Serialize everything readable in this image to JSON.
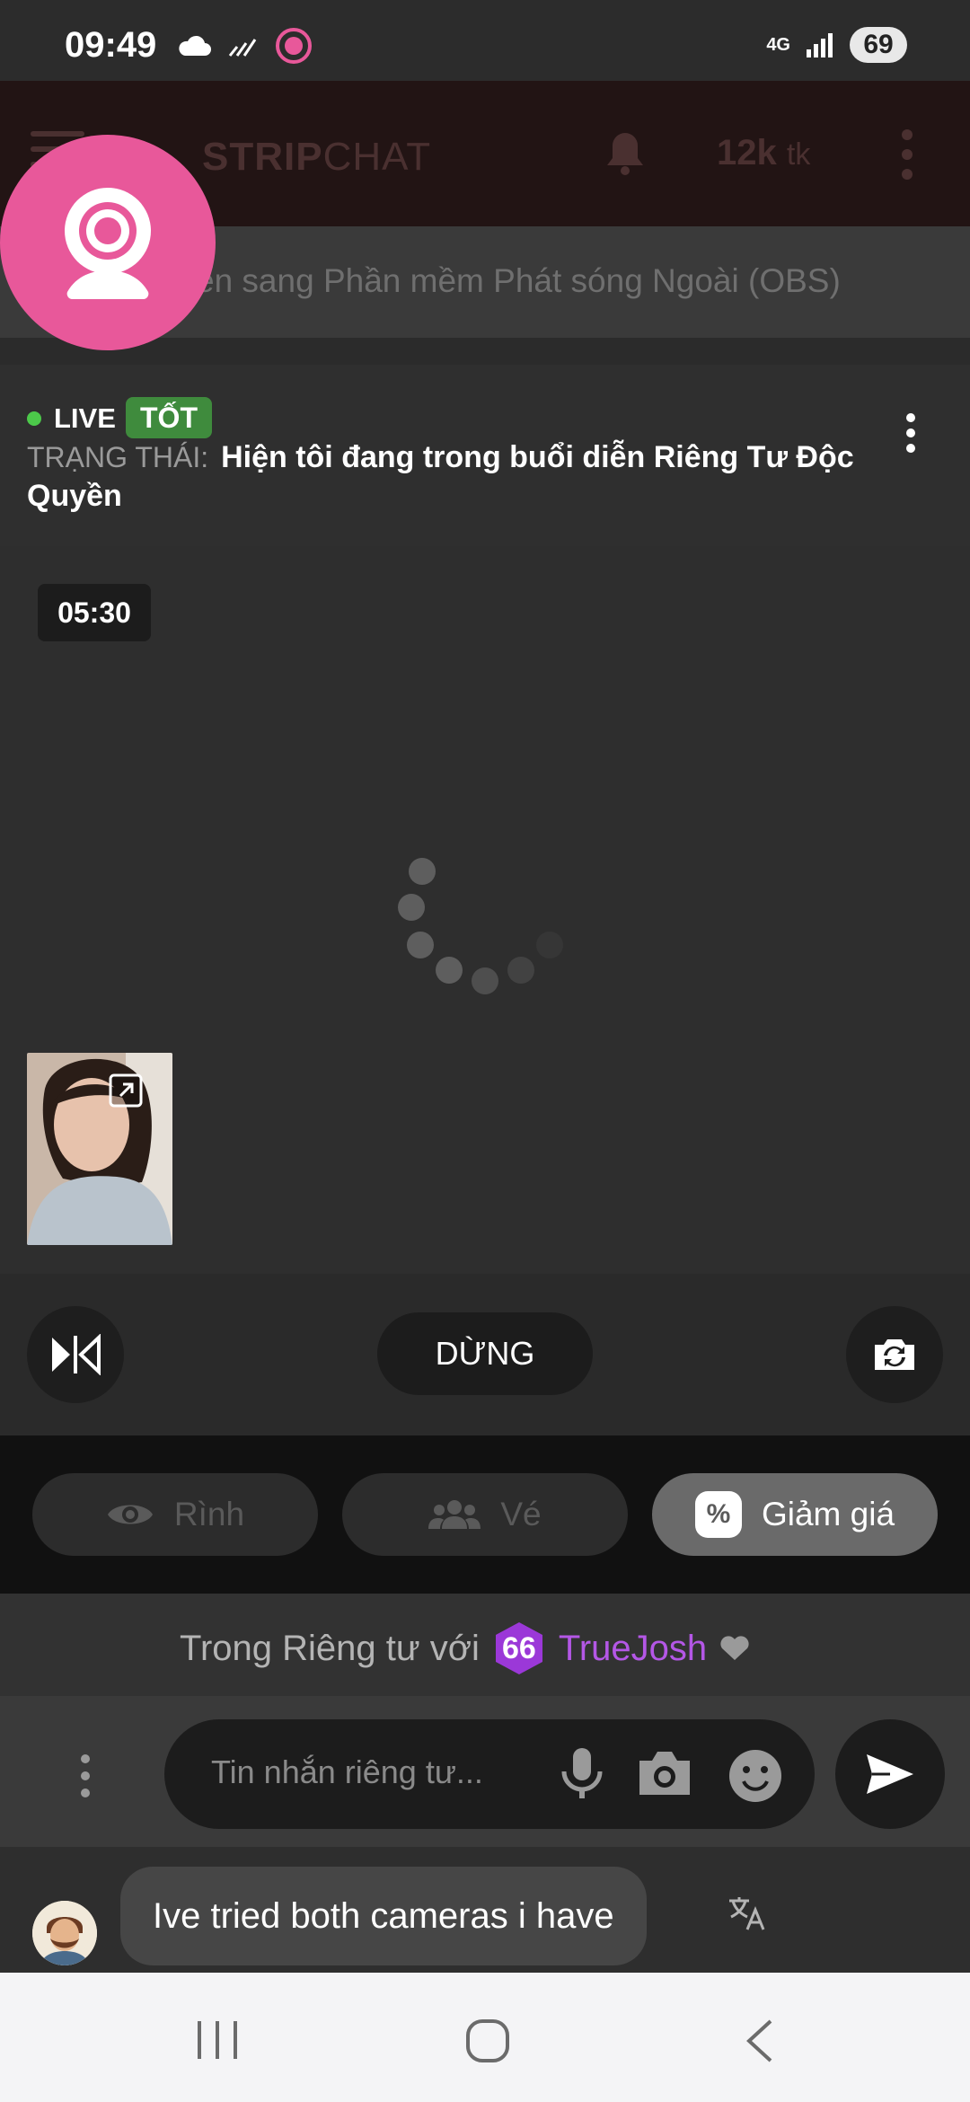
{
  "status_bar": {
    "time": "09:49",
    "network": "4G",
    "battery": "69"
  },
  "app_bar": {
    "brand_bold": "STRIP",
    "brand_thin": "CHAT",
    "tokens_value": "12k",
    "tokens_unit": "tk"
  },
  "obs_banner": {
    "text": "ển sang Phần mềm Phát sóng Ngoài (OBS)"
  },
  "stream_info": {
    "live_label": "LIVE",
    "quality_badge": "TỐT",
    "status_label": "TRẠNG THÁI:",
    "status_value": "Hiện tôi đang trong buổi diễn Riêng Tư Độc Quyền"
  },
  "video": {
    "timer": "05:30"
  },
  "controls": {
    "stop_label": "DỪNG"
  },
  "modes": {
    "spy_label": "Rình",
    "ticket_label": "Vé",
    "discount_label": "Giảm giá",
    "discount_icon_text": "%"
  },
  "private_show": {
    "prefix": "Trong Riêng tư với",
    "level": "66",
    "username": "TrueJosh"
  },
  "composer": {
    "placeholder": "Tin nhắn riêng tư..."
  },
  "chat": {
    "last_message": "Ive tried both cameras i have"
  },
  "colors": {
    "accent_pink": "#e8589a",
    "live_green": "#4cc94a",
    "badge_green": "#3f8b3d",
    "username_purple": "#b457e6"
  }
}
